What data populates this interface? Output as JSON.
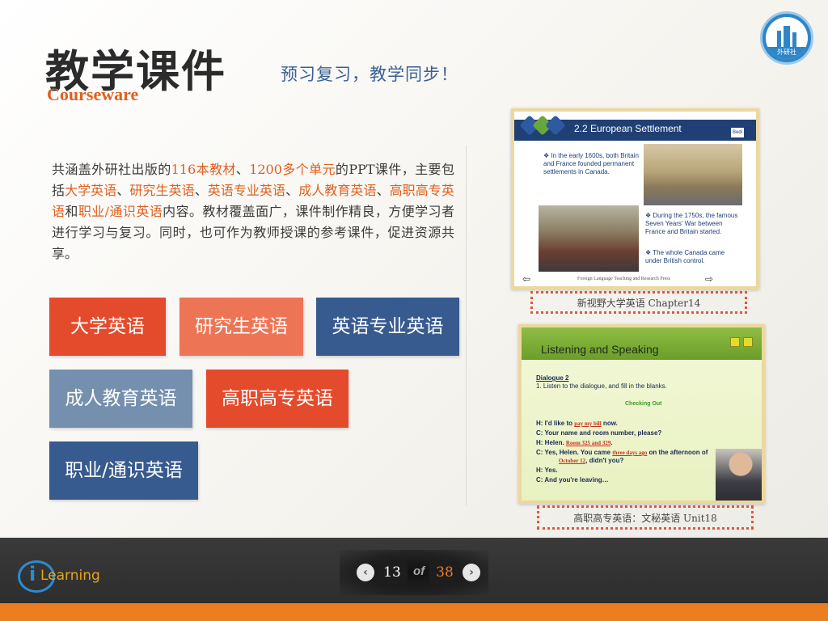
{
  "header": {
    "title": "教学课件",
    "subtitle_en": "Courseware",
    "tagline": "预习复习，教学同步！",
    "logo_text": "外研社"
  },
  "description": {
    "p1": "共涵盖外研社出版的",
    "h1": "116本教材",
    "p2": "、",
    "h2": "1200多个单元",
    "p3": "的PPT课件，主要包括",
    "h3": "大学英语",
    "p4": "、",
    "h4": "研究生英语",
    "p5": "、",
    "h5": "英语专业英语",
    "p6": "、",
    "h6": "成人教育英语",
    "p7": "、",
    "h7": "高职高专英语",
    "p8": "和",
    "h8": "职业/通识英语",
    "p9": "内容。教材覆盖面广，课件制作精良，方便学习者进行学习与复习。同时，也可作为教师授课的参考课件，促进资源共享。"
  },
  "categories": [
    {
      "label": "大学英语",
      "color": "#e34b2c"
    },
    {
      "label": "研究生英语",
      "color": "#ee7456"
    },
    {
      "label": "英语专业英语",
      "color": "#375a8f"
    },
    {
      "label": "成人教育英语",
      "color": "#7590ae"
    },
    {
      "label": "高职高专英语",
      "color": "#e34b2c"
    },
    {
      "label": "职业/通识英语",
      "color": "#375a8f"
    }
  ],
  "preview1": {
    "slide_title": "2.2 European Settlement",
    "corner_badge": "Bedi",
    "bullet1": "❖ In the early 1600s, both Britain and France founded permanent settlements in Canada.",
    "bullet2": "❖ During the 1750s, the famous Seven Years' War between France and Britain started.",
    "bullet3": "❖ The whole Canada came under British control.",
    "footer": "Foreign Language Teaching and Research Press",
    "caption": "新视野大学英语 Chapter14"
  },
  "preview2": {
    "slide_title": "Listening and Speaking",
    "dialogue": "Dialogue 2",
    "instruction": "1.     Listen to the dialogue, and fill in the blanks.",
    "checking": "Checking Out",
    "l1a": "H: I'd like to ",
    "l1f": "pay my bill",
    "l1b": " now.",
    "l2": "C: Your name and room number, please?",
    "l3a": "H: Helen. ",
    "l3f": "Room 325 and 329",
    "l3b": ".",
    "l4a": "C: Yes, Helen. You came ",
    "l4f": "three days ago",
    "l4b": " on the afternoon of",
    "l5f": "October 12",
    "l5b": ", didn't you?",
    "l6": "H: Yes.",
    "l7": "C: And you're leaving…",
    "caption": "高职高专英语：文秘英语 Unit18"
  },
  "brand": {
    "i": "i",
    "text": "Learning"
  },
  "pager": {
    "current": "13",
    "of": "of",
    "total": "38",
    "prev_icon": "chevron-left-icon",
    "next_icon": "chevron-right-icon"
  },
  "colors": {
    "accent_orange": "#e0601f",
    "blue": "#375a8f",
    "red": "#e34b2c"
  }
}
